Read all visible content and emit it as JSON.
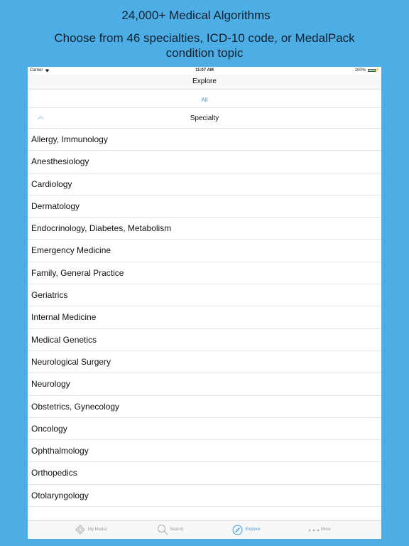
{
  "promo": {
    "headline": "24,000+ Medical Algorithms",
    "subheadline": "Choose from 46 specialties, ICD-10 code, or MedalPack condition topic"
  },
  "status_bar": {
    "carrier": "Carrier",
    "time": "11:07 AM",
    "battery": "100%"
  },
  "nav": {
    "title": "Explore"
  },
  "segment": {
    "all_label": "All"
  },
  "section": {
    "title": "Specialty"
  },
  "specialties": [
    "Allergy, Immunology",
    "Anesthesiology",
    "Cardiology",
    "Dermatology",
    "Endocrinology, Diabetes, Metabolism",
    "Emergency Medicine",
    "Family, General Practice",
    "Geriatrics",
    "Internal Medicine",
    "Medical Genetics",
    "Neurological Surgery",
    "Neurology",
    "Obstetrics, Gynecology",
    "Oncology",
    "Ophthalmology",
    "Orthopedics",
    "Otolaryngology"
  ],
  "tabs": [
    {
      "label": "My Medal",
      "icon": "diamond-icon",
      "active": false
    },
    {
      "label": "Search",
      "icon": "search-icon",
      "active": false
    },
    {
      "label": "Explore",
      "icon": "compass-icon",
      "active": true
    },
    {
      "label": "More",
      "icon": "more-dots-icon",
      "active": false
    }
  ],
  "colors": {
    "background": "#4daee5",
    "accent": "#3b9be0"
  }
}
